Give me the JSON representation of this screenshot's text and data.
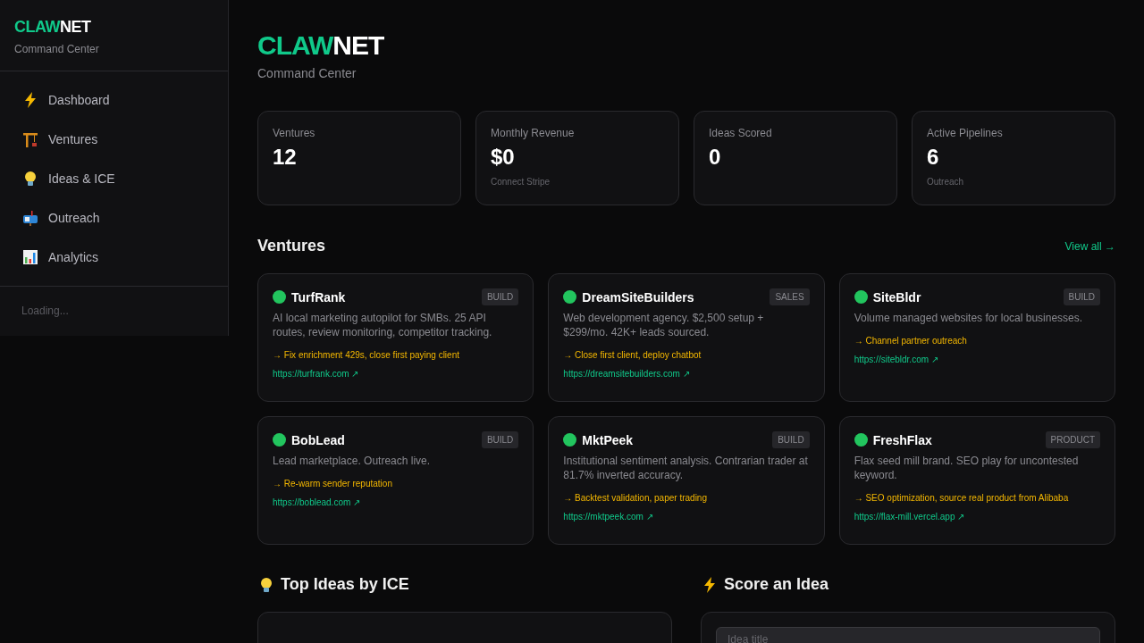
{
  "sidebar": {
    "logo": {
      "accent": "CLAW",
      "rest": "NET"
    },
    "subtitle": "Command Center",
    "items": [
      {
        "label": "Dashboard",
        "kind": "bolt"
      },
      {
        "label": "Ventures",
        "kind": "crane"
      },
      {
        "label": "Ideas & ICE",
        "kind": "bulb"
      },
      {
        "label": "Outreach",
        "kind": "mailbox"
      },
      {
        "label": "Analytics",
        "kind": "chart"
      }
    ],
    "footer": "Loading..."
  },
  "header": {
    "logo": {
      "accent": "CLAW",
      "rest": "NET"
    },
    "subtitle": "Command Center"
  },
  "stats": [
    {
      "label": "Ventures",
      "value": "12"
    },
    {
      "label": "Monthly Revenue",
      "value": "$0",
      "note": "Connect Stripe"
    },
    {
      "label": "Ideas Scored",
      "value": "0"
    },
    {
      "label": "Active Pipelines",
      "value": "6",
      "note": "Outreach"
    }
  ],
  "ventures": {
    "title": "Ventures",
    "link": "View all →",
    "cards": [
      {
        "name": "TurfRank",
        "color": "#22c55e",
        "tag": "BUILD",
        "description": "AI local marketing autopilot for SMBs. 25 API routes, review monitoring, competitor tracking.",
        "next": "→ Fix enrichment 429s, close first paying client",
        "url": "https://turfrank.com ↗"
      },
      {
        "name": "DreamSiteBuilders",
        "color": "#22c55e",
        "tag": "SALES",
        "description": "Web development agency. $2,500 setup + $299/mo. 42K+ leads sourced.",
        "next": "→ Close first client, deploy chatbot",
        "url": "https://dreamsitebuilders.com ↗"
      },
      {
        "name": "SiteBldr",
        "color": "#22c55e",
        "tag": "BUILD",
        "description": "Volume managed websites for local businesses.",
        "next": "→ Channel partner outreach",
        "url": "https://sitebldr.com ↗"
      },
      {
        "name": "BobLead",
        "color": "#22c55e",
        "tag": "BUILD",
        "description": "Lead marketplace. Outreach live.",
        "next": "→ Re-warm sender reputation",
        "url": "https://boblead.com ↗"
      },
      {
        "name": "MktPeek",
        "color": "#22c55e",
        "tag": "BUILD",
        "description": "Institutional sentiment analysis. Contrarian trader at 81.7% inverted accuracy.",
        "next": "→ Backtest validation, paper trading",
        "url": "https://mktpeek.com ↗"
      },
      {
        "name": "FreshFlax",
        "color": "#22c55e",
        "tag": "PRODUCT",
        "description": "Flax seed mill brand. SEO play for uncontested keyword.",
        "next": "→ SEO optimization, source real product from Alibaba",
        "url": "https://flax-mill.vercel.app ↗"
      }
    ]
  },
  "top_ideas": {
    "title": "Top Ideas by ICE",
    "kind": "bulb"
  },
  "score_idea": {
    "title": "Score an Idea",
    "kind": "bolt",
    "placeholder": "Idea title"
  }
}
